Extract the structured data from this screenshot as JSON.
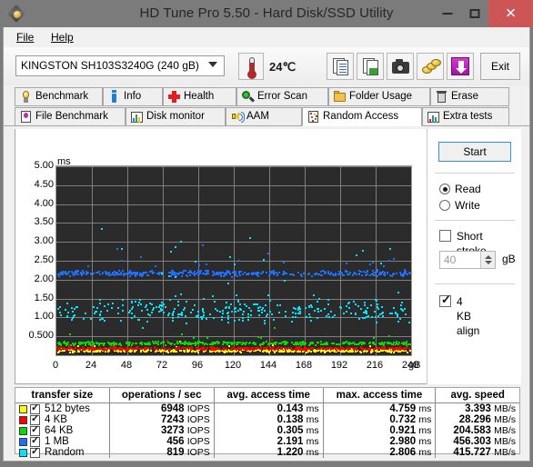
{
  "window": {
    "title": "HD Tune Pro 5.50 - Hard Disk/SSD Utility",
    "icon": "hard-disk-icon",
    "minimize": "–",
    "maximize": "□",
    "close": "✕",
    "titlebar_color": "#7b7b7b",
    "close_color": "#cc5555"
  },
  "menu": {
    "file": "File",
    "help": "Help"
  },
  "toolbar": {
    "drive": "KINGSTON SH103S3240G (240 gB)",
    "temperature": "24℃",
    "exit_label": "Exit",
    "buttons": [
      {
        "name": "copy-text-icon"
      },
      {
        "name": "copy-image-icon"
      },
      {
        "name": "screenshot-icon"
      },
      {
        "name": "donate-icon"
      },
      {
        "name": "download-icon"
      }
    ]
  },
  "tabs": {
    "row1": [
      {
        "label": "Benchmark",
        "icon": "bulb-icon",
        "selected": false
      },
      {
        "label": "Info",
        "icon": "info-icon",
        "selected": false
      },
      {
        "label": "Health",
        "icon": "health-cross-icon",
        "selected": false
      },
      {
        "label": "Error Scan",
        "icon": "magnifier-icon",
        "selected": false
      },
      {
        "label": "Folder Usage",
        "icon": "folder-icon",
        "selected": false
      },
      {
        "label": "Erase",
        "icon": "trash-icon",
        "selected": false
      }
    ],
    "row2": [
      {
        "label": "File Benchmark",
        "icon": "file-benchmark-icon",
        "selected": false
      },
      {
        "label": "Disk monitor",
        "icon": "bar-chart-icon",
        "selected": false
      },
      {
        "label": "AAM",
        "icon": "speaker-icon",
        "selected": false
      },
      {
        "label": "Random Access",
        "icon": "random-access-icon",
        "selected": true
      },
      {
        "label": "Extra tests",
        "icon": "extra-tests-icon",
        "selected": false
      }
    ]
  },
  "controls": {
    "start_label": "Start",
    "mode": {
      "read": "Read",
      "write": "Write",
      "selected": "Read"
    },
    "short_stroke": {
      "label": "Short stroke",
      "checked": false
    },
    "short_stroke_value": "40",
    "short_stroke_unit": "gB",
    "align": {
      "label": "4 KB align",
      "checked": true
    }
  },
  "chart_data": {
    "type": "scatter",
    "title": "",
    "xlabel": "gB",
    "ylabel": "ms",
    "xlim": [
      0,
      240
    ],
    "ylim": [
      0,
      5.0
    ],
    "grid": true,
    "xticks": [
      0,
      24,
      48,
      72,
      96,
      120,
      144,
      168,
      192,
      216,
      240
    ],
    "xtick_labels": [
      "0",
      "24",
      "48",
      "72",
      "96",
      "120",
      "144",
      "168",
      "192",
      "216",
      "240"
    ],
    "yticks": [
      0.5,
      1.0,
      1.5,
      2.0,
      2.5,
      3.0,
      3.5,
      4.0,
      4.5,
      5.0
    ],
    "ytick_labels": [
      "0.500",
      "1.00",
      "1.50",
      "2.00",
      "2.50",
      "3.00",
      "3.50",
      "4.00",
      "4.50",
      "5.00"
    ],
    "background": "#2b2b2b",
    "gridcolor": "#8d8d8d",
    "legend_position": "table-below",
    "series": [
      {
        "name": "512 bytes",
        "color": "#ffff00",
        "band_center": 0.143,
        "band_spread": 0.07,
        "count": 420,
        "outlier_rate": 0.01
      },
      {
        "name": "4 KB",
        "color": "#ff0000",
        "band_center": 0.2,
        "band_spread": 0.07,
        "count": 420,
        "outlier_rate": 0.01
      },
      {
        "name": "64 KB",
        "color": "#00dd00",
        "band_center": 0.34,
        "band_spread": 0.08,
        "count": 400,
        "outlier_rate": 0.02
      },
      {
        "name": "1 MB",
        "color": "#1e6fff",
        "band_center": 2.19,
        "band_spread": 0.13,
        "count": 430,
        "outlier_rate": 0.03
      },
      {
        "name": "Random",
        "color": "#00e5ff",
        "band_center": 1.22,
        "band_spread": 0.62,
        "count": 330,
        "outlier_rate": 0.05
      }
    ]
  },
  "table": {
    "headers": [
      "transfer size",
      "operations / sec",
      "avg. access time",
      "max. access time",
      "avg. speed"
    ],
    "rows": [
      {
        "color": "#ffff00",
        "checked": true,
        "size": "512 bytes",
        "ops": "6948 IOPS",
        "avg": "0.143 ms",
        "max": "4.759 ms",
        "speed": "3.393 MB/s"
      },
      {
        "color": "#ff0000",
        "checked": true,
        "size": "4 KB",
        "ops": "7243 IOPS",
        "avg": "0.138 ms",
        "max": "0.732 ms",
        "speed": "28.296 MB/s"
      },
      {
        "color": "#00dd00",
        "checked": true,
        "size": "64 KB",
        "ops": "3273 IOPS",
        "avg": "0.305 ms",
        "max": "0.921 ms",
        "speed": "204.583 MB/s"
      },
      {
        "color": "#1e6fff",
        "checked": true,
        "size": "1 MB",
        "ops": "456 IOPS",
        "avg": "2.191 ms",
        "max": "2.980 ms",
        "speed": "456.303 MB/s"
      },
      {
        "color": "#00e5ff",
        "checked": true,
        "size": "Random",
        "ops": "819 IOPS",
        "avg": "1.220 ms",
        "max": "2.806 ms",
        "speed": "415.727 MB/s"
      }
    ]
  }
}
